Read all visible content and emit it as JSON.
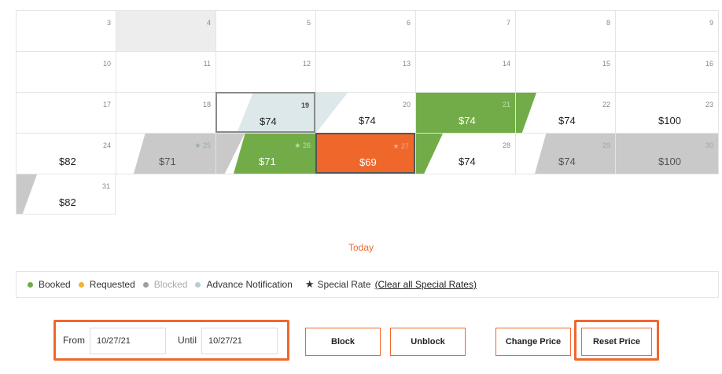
{
  "calendar": {
    "rows": [
      [
        {
          "day": "3"
        },
        {
          "day": "4"
        },
        {
          "day": "5"
        },
        {
          "day": "6"
        },
        {
          "day": "7"
        },
        {
          "day": "8"
        },
        {
          "day": "9"
        }
      ],
      [
        {
          "day": "10"
        },
        {
          "day": "11"
        },
        {
          "day": "12"
        },
        {
          "day": "13"
        },
        {
          "day": "14"
        },
        {
          "day": "15"
        },
        {
          "day": "16"
        }
      ],
      [
        {
          "day": "17"
        },
        {
          "day": "18"
        },
        {
          "day": "19",
          "price": "$74"
        },
        {
          "day": "20",
          "price": "$74"
        },
        {
          "day": "21",
          "price": "$74"
        },
        {
          "day": "22",
          "price": "$74"
        },
        {
          "day": "23",
          "price": "$100"
        }
      ],
      [
        {
          "day": "24",
          "price": "$82"
        },
        {
          "day": "25",
          "price": "$71"
        },
        {
          "day": "26",
          "price": "$71"
        },
        {
          "day": "27",
          "price": "$69"
        },
        {
          "day": "28",
          "price": "$74"
        },
        {
          "day": "29",
          "price": "$74"
        },
        {
          "day": "30",
          "price": "$100"
        }
      ],
      [
        {
          "day": "31",
          "price": "$82"
        }
      ]
    ],
    "star_glyph": "★"
  },
  "today_label": "Today",
  "legend": {
    "booked": "Booked",
    "requested": "Requested",
    "blocked": "Blocked",
    "advance": "Advance Notification",
    "special": "Special Rate",
    "clear_link": "(Clear all Special Rates)",
    "star": "★",
    "colors": {
      "booked": "#72ac48",
      "requested": "#f2b233",
      "blocked": "#9e9e9e",
      "advance": "#b9ccd1"
    }
  },
  "controls": {
    "from_label": "From",
    "from_value": "10/27/21",
    "until_label": "Until",
    "until_value": "10/27/21",
    "block": "Block",
    "unblock": "Unblock",
    "change_price": "Change Price",
    "reset_price": "Reset Price"
  },
  "colors": {
    "accent": "#f0672c"
  }
}
